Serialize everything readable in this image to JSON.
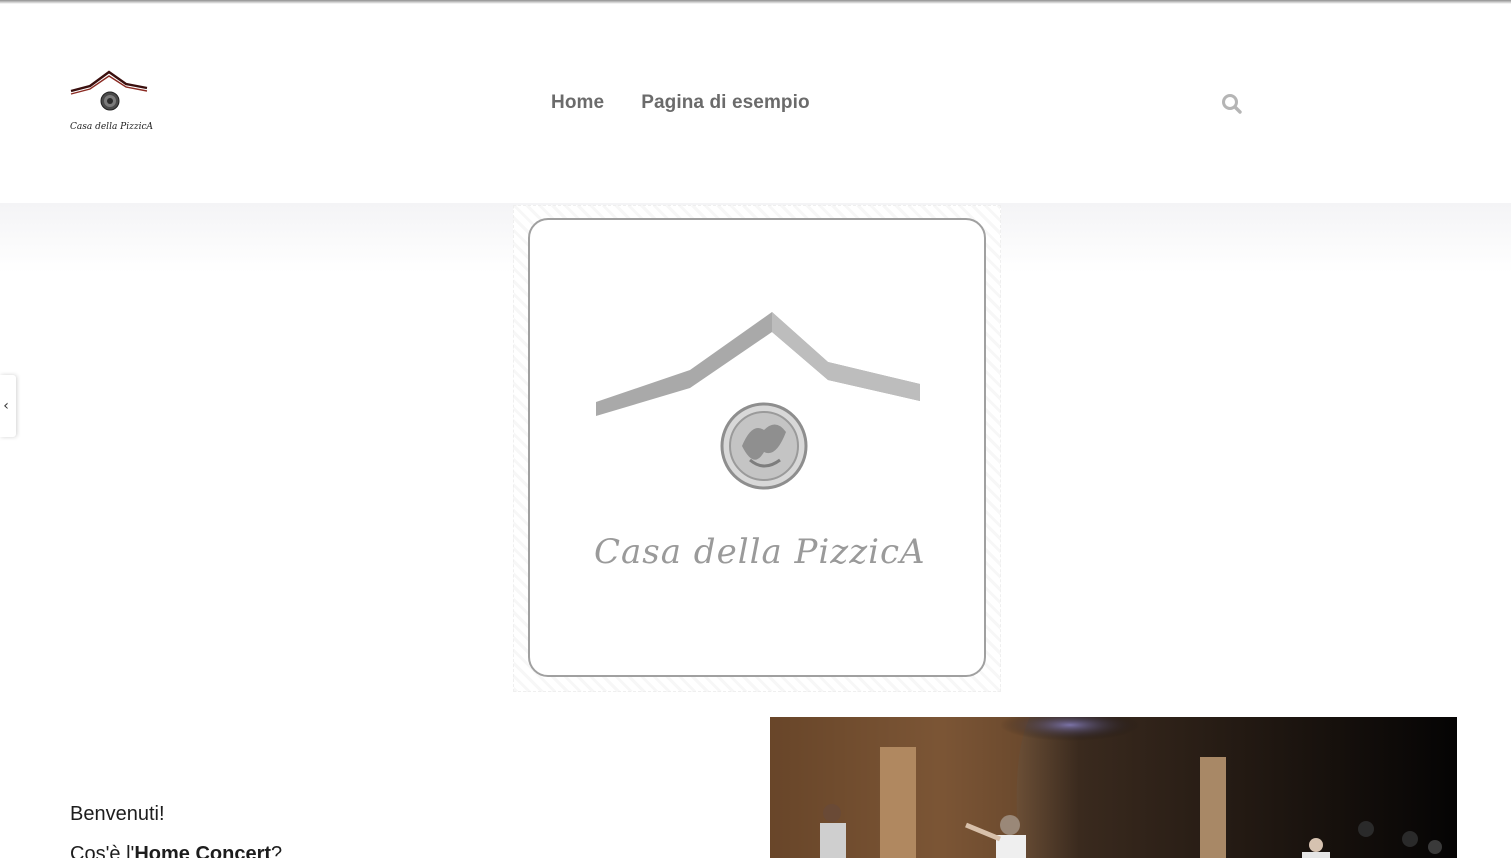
{
  "header": {
    "logo": {
      "icon": "house-roof-seal-logo",
      "wordmark": "Casa della PizzicA"
    },
    "nav": [
      {
        "label": "Home"
      },
      {
        "label": "Pagina di esempio"
      }
    ],
    "search": {
      "icon": "search-icon"
    }
  },
  "hero": {
    "logo": {
      "icon": "house-roof-seal-logo",
      "wordmark": "Casa della PizzicA"
    },
    "prev_arrow": "‹"
  },
  "intro": {
    "greeting": "Benvenuti!",
    "question_prefix": "Cos'è l'",
    "question_bold": "Home Concert",
    "question_suffix": "?"
  },
  "video": {
    "description": "night concert scene video thumbnail"
  },
  "colors": {
    "nav_text": "#6b6b6b",
    "logo_roof": "#4a1412",
    "hero_gray": "#a8a8a8",
    "card_border": "#a0a0a0"
  }
}
